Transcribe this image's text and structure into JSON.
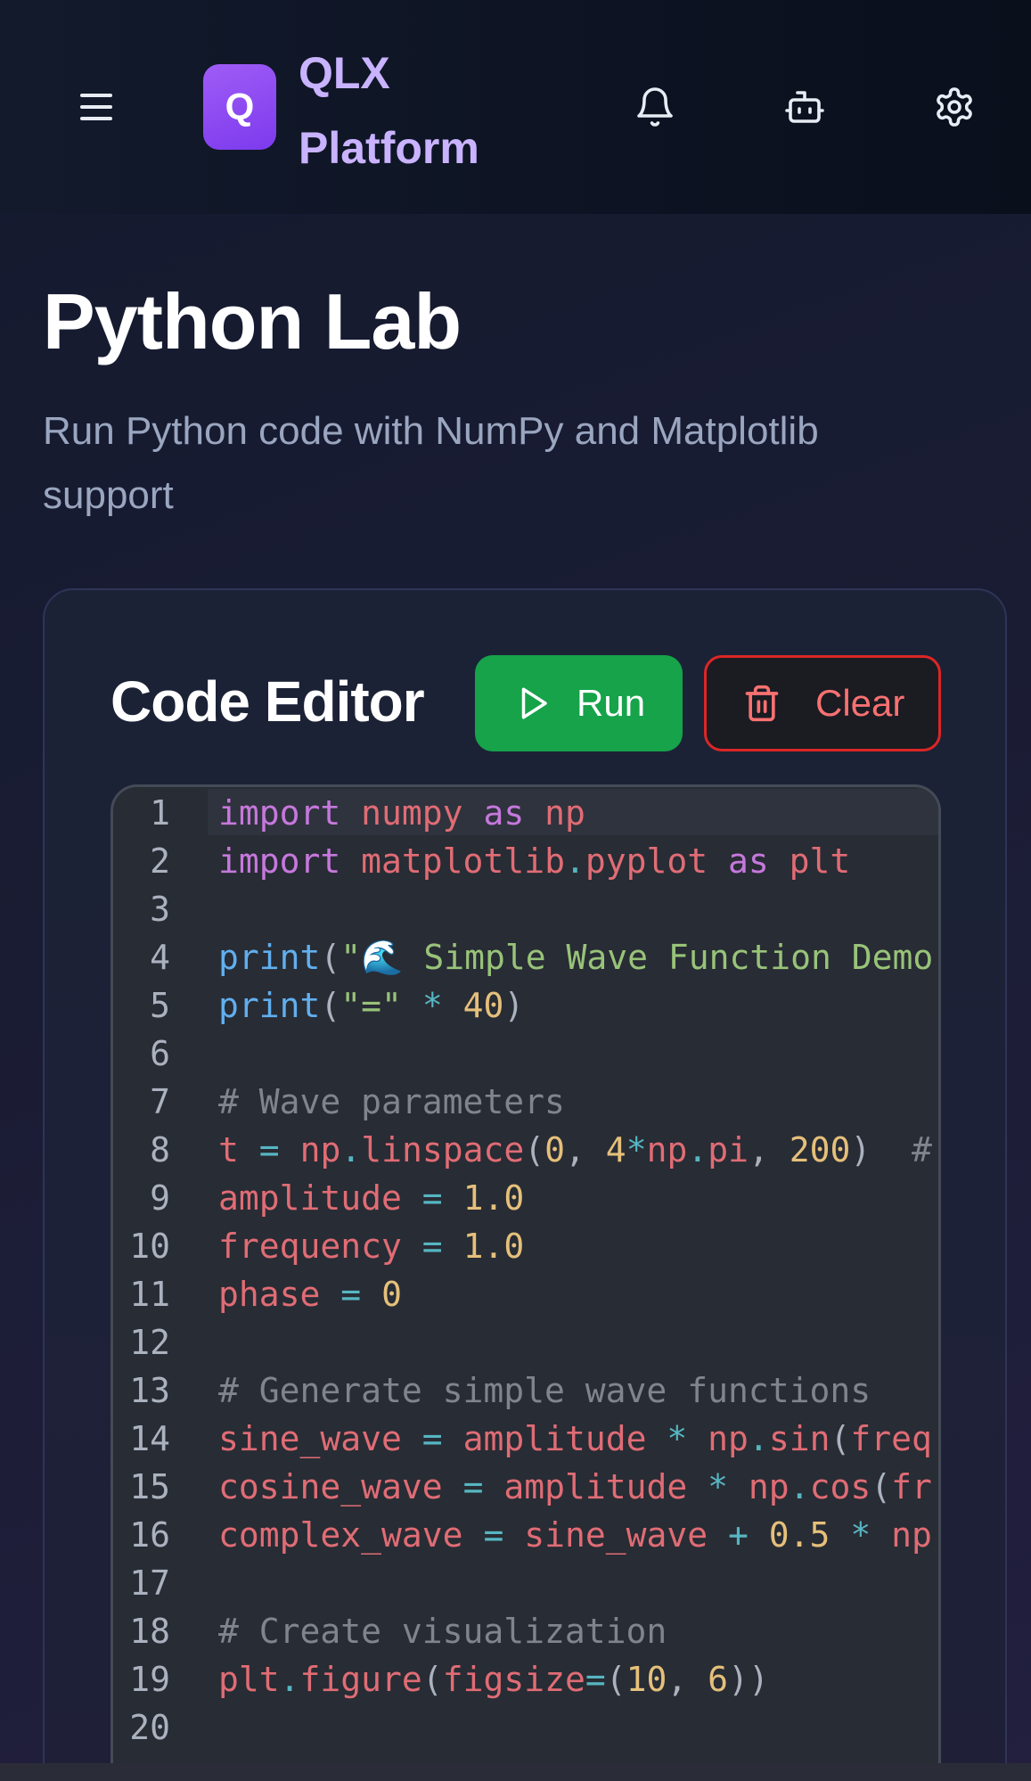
{
  "header": {
    "menu_icon": "hamburger-menu-icon",
    "logo_letter": "Q",
    "logo_line1": "QLX",
    "logo_line2": "Platform",
    "icons": [
      "bell-icon",
      "bot-icon",
      "gear-icon"
    ]
  },
  "page": {
    "title": "Python Lab",
    "subtitle": "Run Python code with NumPy and Matplotlib support"
  },
  "editor_card": {
    "title": "Code Editor",
    "run_label": "Run",
    "clear_label": "Clear"
  },
  "code_lines": [
    {
      "n": "1",
      "parts": [
        [
          "kw",
          "import"
        ],
        [
          "pn",
          " "
        ],
        [
          "vr",
          "numpy"
        ],
        [
          "pn",
          " "
        ],
        [
          "kw",
          "as"
        ],
        [
          "pn",
          " "
        ],
        [
          "vr",
          "np"
        ]
      ]
    },
    {
      "n": "2",
      "parts": [
        [
          "kw",
          "import"
        ],
        [
          "pn",
          " "
        ],
        [
          "vr",
          "matplotlib"
        ],
        [
          "op",
          "."
        ],
        [
          "vr",
          "pyplot"
        ],
        [
          "pn",
          " "
        ],
        [
          "kw",
          "as"
        ],
        [
          "pn",
          " "
        ],
        [
          "vr",
          "plt"
        ]
      ]
    },
    {
      "n": "3",
      "parts": []
    },
    {
      "n": "4",
      "parts": [
        [
          "fn",
          "print"
        ],
        [
          "pn",
          "("
        ],
        [
          "st",
          "\"🌊 Simple Wave Function Demo"
        ]
      ]
    },
    {
      "n": "5",
      "parts": [
        [
          "fn",
          "print"
        ],
        [
          "pn",
          "("
        ],
        [
          "st",
          "\"=\""
        ],
        [
          "pn",
          " "
        ],
        [
          "op",
          "*"
        ],
        [
          "pn",
          " "
        ],
        [
          "nu",
          "40"
        ],
        [
          "pn",
          ")"
        ]
      ]
    },
    {
      "n": "6",
      "parts": []
    },
    {
      "n": "7",
      "parts": [
        [
          "cm",
          "# Wave parameters"
        ]
      ]
    },
    {
      "n": "8",
      "parts": [
        [
          "vr",
          "t"
        ],
        [
          "pn",
          " "
        ],
        [
          "op",
          "="
        ],
        [
          "pn",
          " "
        ],
        [
          "vr",
          "np"
        ],
        [
          "op",
          "."
        ],
        [
          "vr",
          "linspace"
        ],
        [
          "pn",
          "("
        ],
        [
          "nu",
          "0"
        ],
        [
          "pn",
          ", "
        ],
        [
          "nu",
          "4"
        ],
        [
          "op",
          "*"
        ],
        [
          "vr",
          "np"
        ],
        [
          "op",
          "."
        ],
        [
          "vr",
          "pi"
        ],
        [
          "pn",
          ", "
        ],
        [
          "nu",
          "200"
        ],
        [
          "pn",
          ")  "
        ],
        [
          "cm",
          "#"
        ]
      ]
    },
    {
      "n": "9",
      "parts": [
        [
          "vr",
          "amplitude"
        ],
        [
          "pn",
          " "
        ],
        [
          "op",
          "="
        ],
        [
          "pn",
          " "
        ],
        [
          "nu",
          "1.0"
        ]
      ]
    },
    {
      "n": "10",
      "parts": [
        [
          "vr",
          "frequency"
        ],
        [
          "pn",
          " "
        ],
        [
          "op",
          "="
        ],
        [
          "pn",
          " "
        ],
        [
          "nu",
          "1.0"
        ]
      ]
    },
    {
      "n": "11",
      "parts": [
        [
          "vr",
          "phase"
        ],
        [
          "pn",
          " "
        ],
        [
          "op",
          "="
        ],
        [
          "pn",
          " "
        ],
        [
          "nu",
          "0"
        ]
      ]
    },
    {
      "n": "12",
      "parts": []
    },
    {
      "n": "13",
      "parts": [
        [
          "cm",
          "# Generate simple wave functions"
        ]
      ]
    },
    {
      "n": "14",
      "parts": [
        [
          "vr",
          "sine_wave"
        ],
        [
          "pn",
          " "
        ],
        [
          "op",
          "="
        ],
        [
          "pn",
          " "
        ],
        [
          "vr",
          "amplitude"
        ],
        [
          "pn",
          " "
        ],
        [
          "op",
          "*"
        ],
        [
          "pn",
          " "
        ],
        [
          "vr",
          "np"
        ],
        [
          "op",
          "."
        ],
        [
          "vr",
          "sin"
        ],
        [
          "pn",
          "("
        ],
        [
          "vr",
          "freq"
        ]
      ]
    },
    {
      "n": "15",
      "parts": [
        [
          "vr",
          "cosine_wave"
        ],
        [
          "pn",
          " "
        ],
        [
          "op",
          "="
        ],
        [
          "pn",
          " "
        ],
        [
          "vr",
          "amplitude"
        ],
        [
          "pn",
          " "
        ],
        [
          "op",
          "*"
        ],
        [
          "pn",
          " "
        ],
        [
          "vr",
          "np"
        ],
        [
          "op",
          "."
        ],
        [
          "vr",
          "cos"
        ],
        [
          "pn",
          "("
        ],
        [
          "vr",
          "fr"
        ]
      ]
    },
    {
      "n": "16",
      "parts": [
        [
          "vr",
          "complex_wave"
        ],
        [
          "pn",
          " "
        ],
        [
          "op",
          "="
        ],
        [
          "pn",
          " "
        ],
        [
          "vr",
          "sine_wave"
        ],
        [
          "pn",
          " "
        ],
        [
          "op",
          "+"
        ],
        [
          "pn",
          " "
        ],
        [
          "nu",
          "0.5"
        ],
        [
          "pn",
          " "
        ],
        [
          "op",
          "*"
        ],
        [
          "pn",
          " "
        ],
        [
          "vr",
          "np"
        ]
      ]
    },
    {
      "n": "17",
      "parts": []
    },
    {
      "n": "18",
      "parts": [
        [
          "cm",
          "# Create visualization"
        ]
      ]
    },
    {
      "n": "19",
      "parts": [
        [
          "vr",
          "plt"
        ],
        [
          "op",
          "."
        ],
        [
          "vr",
          "figure"
        ],
        [
          "pn",
          "("
        ],
        [
          "vr",
          "figsize"
        ],
        [
          "op",
          "="
        ],
        [
          "pn",
          "("
        ],
        [
          "nu",
          "10"
        ],
        [
          "pn",
          ", "
        ],
        [
          "nu",
          "6"
        ],
        [
          "pn",
          "))"
        ]
      ]
    },
    {
      "n": "20",
      "parts": []
    }
  ]
}
